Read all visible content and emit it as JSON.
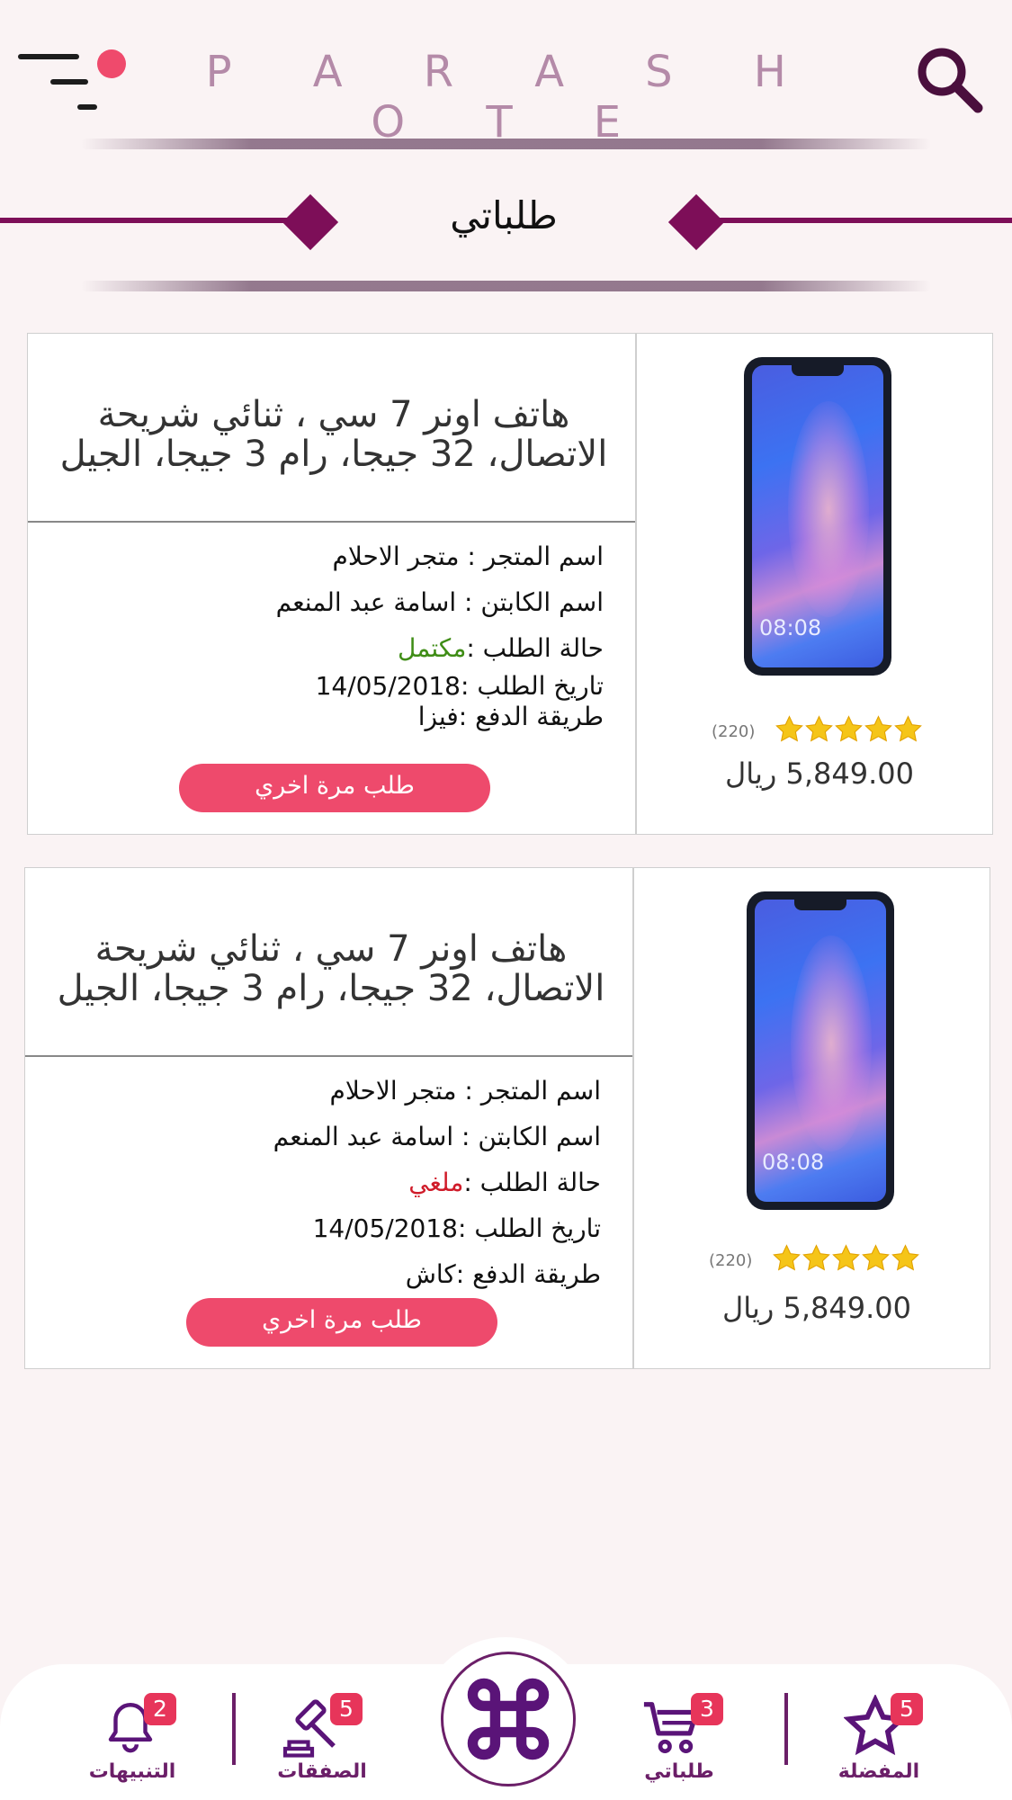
{
  "header": {
    "brand": "P A R A S H O T E"
  },
  "section": {
    "title": "طلباتي"
  },
  "orders": [
    {
      "title": "هاتف اونر 7 سي ، ثنائي شريحة الاتصال، 32 جيجا، رام 3 جيجا، الجيل",
      "store_label": "اسم المتجر :",
      "store": "متجر الاحلام",
      "captain_label": "اسم الكابتن :",
      "captain": "اسامة عبد المنعم",
      "status_label": "حالة الطلب :",
      "status": "مكتمل",
      "status_color": "#3f8d16",
      "date_label": "تاريخ الطلب :",
      "date": "14/05/2018",
      "payment_label": "طريقة الدفع :",
      "payment": "فيزا",
      "reorder_label": "طلب مرة اخري",
      "rating": 5,
      "rating_count": "(220)",
      "price": "5,849.00 ريال",
      "phone_time": "08:08"
    },
    {
      "title": "هاتف اونر 7 سي ، ثنائي شريحة الاتصال، 32 جيجا، رام 3 جيجا، الجيل",
      "store_label": "اسم المتجر :",
      "store": "متجر الاحلام",
      "captain_label": "اسم الكابتن :",
      "captain": "اسامة عبد المنعم",
      "status_label": "حالة الطلب :",
      "status": "ملغي",
      "status_color": "#d01c2a",
      "date_label": "تاريخ الطلب :",
      "date": "14/05/2018",
      "payment_label": "طريقة الدفع :",
      "payment": "كاش",
      "reorder_label": "طلب مرة اخري",
      "rating": 5,
      "rating_count": "(220)",
      "price": "5,849.00 ريال",
      "phone_time": "08:08"
    }
  ],
  "nav": {
    "favorites": {
      "label": "المفضلة",
      "badge": "5",
      "icon": "star-icon"
    },
    "my_orders": {
      "label": "طلباتي",
      "badge": "3",
      "icon": "cart-icon"
    },
    "center": {
      "icon": "command-icon"
    },
    "deals": {
      "label": "الصفقات",
      "badge": "5",
      "icon": "gavel-icon"
    },
    "notifications": {
      "label": "التنبيهات",
      "badge": "2",
      "icon": "bell-icon"
    }
  },
  "colors": {
    "brand_purple": "#7d0e58",
    "accent_pink": "#ee4a6c",
    "star_gold": "#f5c518"
  }
}
